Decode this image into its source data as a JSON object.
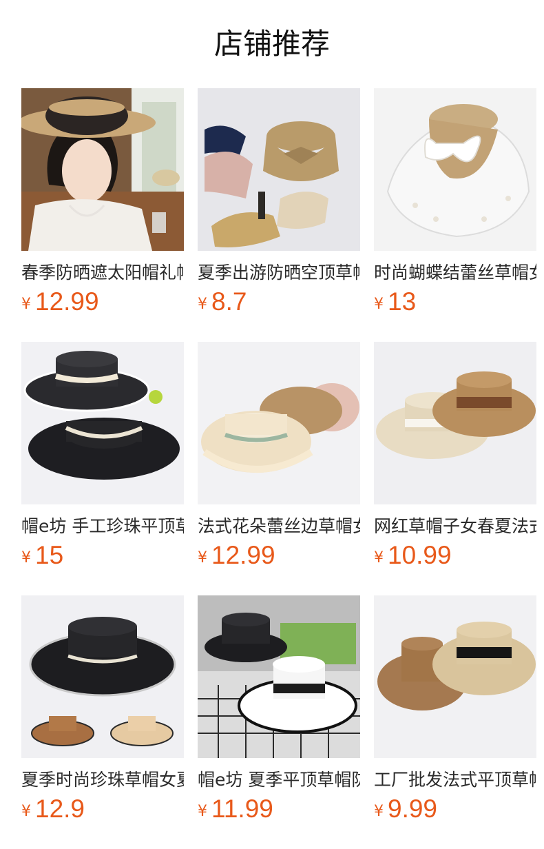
{
  "header": {
    "title": "店铺推荐"
  },
  "currency_symbol": "¥",
  "colors": {
    "price": "#e8591a",
    "title": "#111111",
    "name": "#2a2a2a"
  },
  "products": [
    {
      "name": "春季防晒遮太阳帽礼帽女",
      "price": "12.99",
      "image_icon": "woman-wearing-straw-hat"
    },
    {
      "name": "夏季出游防晒空顶草帽女",
      "price": "8.7",
      "image_icon": "rolled-visor-hats"
    },
    {
      "name": "时尚蝴蝶结蕾丝草帽女夏",
      "price": "13",
      "image_icon": "lace-bow-straw-hat"
    },
    {
      "name": "帽e坊 手工珍珠平顶草帽",
      "price": "15",
      "image_icon": "black-pearl-boater-hat"
    },
    {
      "name": "法式花朵蕾丝边草帽女夏",
      "price": "12.99",
      "image_icon": "lace-trim-straw-hats"
    },
    {
      "name": "网红草帽子女春夏法式平",
      "price": "10.99",
      "image_icon": "two-boater-hats"
    },
    {
      "name": "夏季时尚珍珠草帽女夏季",
      "price": "12.9",
      "image_icon": "pearl-trim-boater-hats"
    },
    {
      "name": "帽e坊 夏季平顶草帽防晒",
      "price": "11.99",
      "image_icon": "black-white-boater-hats"
    },
    {
      "name": "工厂批发法式平顶草帽女",
      "price": "9.99",
      "image_icon": "ribbon-boater-hats"
    }
  ]
}
